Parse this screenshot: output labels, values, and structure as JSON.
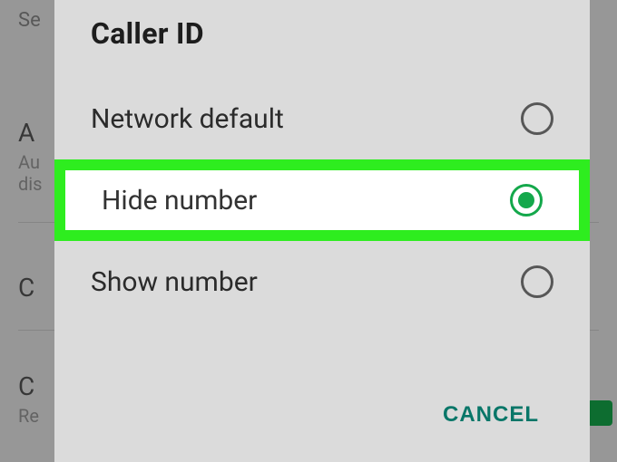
{
  "background": {
    "search": "Se",
    "items": [
      {
        "title": "A",
        "sub1": "Au",
        "sub2": "dis"
      },
      {
        "title": "C"
      },
      {
        "title": "C",
        "sub1": "Re"
      }
    ]
  },
  "dialog": {
    "title": "Caller ID",
    "options": [
      {
        "label": "Network default",
        "selected": false,
        "highlighted": false
      },
      {
        "label": "Hide number",
        "selected": true,
        "highlighted": true
      },
      {
        "label": "Show number",
        "selected": false,
        "highlighted": false
      }
    ],
    "cancel_label": "CANCEL"
  },
  "accent_color": "#14a84b",
  "highlight_color": "#2eed1f"
}
